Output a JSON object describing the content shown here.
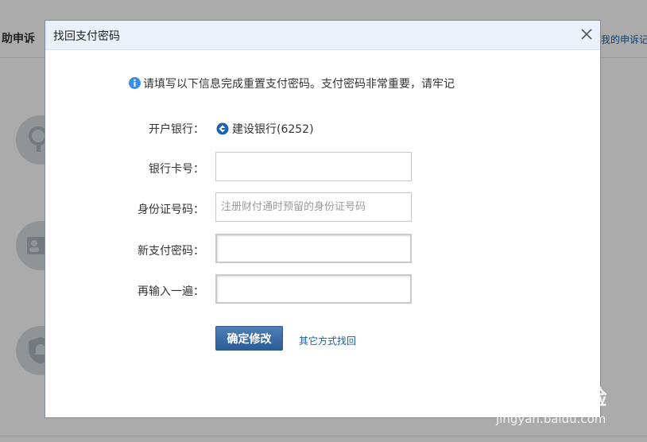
{
  "background": {
    "left_title": "助申诉",
    "right_link": "我的申诉记"
  },
  "dialog": {
    "title": "找回支付密码",
    "notice": "请填写以下信息完成重置支付密码。支付密码非常重要，请牢记",
    "form": {
      "bank_label": "开户银行：",
      "bank_value": "建设银行(6252)",
      "card_label": "银行卡号：",
      "card_value": "",
      "id_label": "身份证号码：",
      "id_placeholder": "注册财付通时预留的身份证号码",
      "new_pwd_label": "新支付密码：",
      "confirm_pwd_label": "再输入一遍："
    },
    "submit_label": "确定修改",
    "alt_link": "其它方式找回"
  },
  "watermark": {
    "brand": "Baidu经验",
    "url": "jingyan.baidu.com"
  },
  "colors": {
    "link": "#1a5ea8",
    "button": "#2d5d97",
    "header_bg": "#eaf1fa",
    "info_icon": "#3a8ee6",
    "bank_icon": "#1b62b3"
  }
}
